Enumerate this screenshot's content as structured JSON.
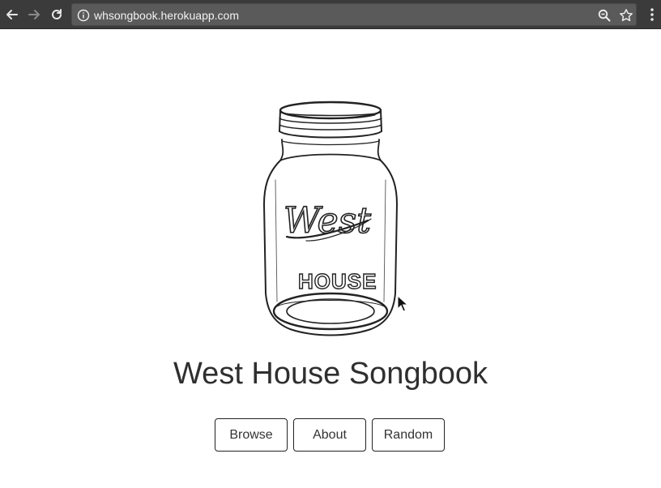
{
  "browser": {
    "url": "whsongbook.herokuapp.com",
    "icons": {
      "back": "back-arrow-icon",
      "forward": "forward-arrow-icon",
      "reload": "reload-icon",
      "info": "info-icon",
      "zoom": "zoom-icon",
      "bookmark": "star-icon",
      "menu": "kebab-menu-icon"
    }
  },
  "jar": {
    "script_word": "West",
    "caps_word": "HOUSE"
  },
  "page": {
    "title": "West House Songbook"
  },
  "nav": {
    "browse": "Browse",
    "about": "About",
    "random": "Random"
  },
  "colors": {
    "chrome_bg": "#3b3b3b",
    "omnibox_bg": "#5a5a5a",
    "title_text": "#2f2f2f"
  }
}
